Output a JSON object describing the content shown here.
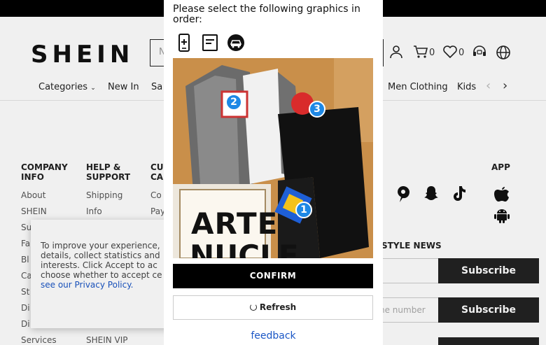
{
  "header": {
    "logo": "SHEIN",
    "search_placeholder": "N",
    "cart_count": "0",
    "wishlist_count": "0"
  },
  "nav": {
    "items": [
      "Categories",
      "New In",
      "Sa",
      "Men Clothing",
      "Kids"
    ]
  },
  "footer": {
    "company_heading_1": "COMPANY",
    "company_heading_2": "INFO",
    "company_links": [
      "About",
      "SHEIN",
      "Su",
      "Fa",
      "Bl",
      "Ca",
      "St",
      "Di",
      "Di",
      "Services"
    ],
    "help_heading_1": "HELP &",
    "help_heading_2": "SUPPORT",
    "help_links": [
      "Shipping",
      "Info",
      "SHEIN VIP"
    ],
    "cust_heading_1": "CU",
    "cust_heading_2": "CA",
    "cust_links": [
      "Co",
      "Pay"
    ],
    "app_heading": "APP",
    "news_heading": "STYLE NEWS",
    "news_phone_placeholder": "he number",
    "subscribe_label": "Subscribe"
  },
  "cookie": {
    "text_1": "To improve your experience,",
    "text_2": "details, collect statistics and",
    "text_3": "interests. Click Accept to ac",
    "text_4": "choose whether to accept ce",
    "link": "see our Privacy Policy."
  },
  "captcha": {
    "instruction": "Please select the following graphics in order:",
    "target_icons": [
      "phone-plus-icon",
      "document-icon",
      "car-badge-icon"
    ],
    "badges": [
      "2",
      "3",
      "1"
    ],
    "image_caption_1": "ARTE",
    "image_caption_2": "NUCLE",
    "confirm_label": "CONFIRM",
    "refresh_label": "Refresh",
    "feedback_label": "feedback"
  },
  "colors": {
    "accent_blue": "#1e88e5",
    "link_blue": "#1a56c5",
    "button_black": "#000000"
  }
}
